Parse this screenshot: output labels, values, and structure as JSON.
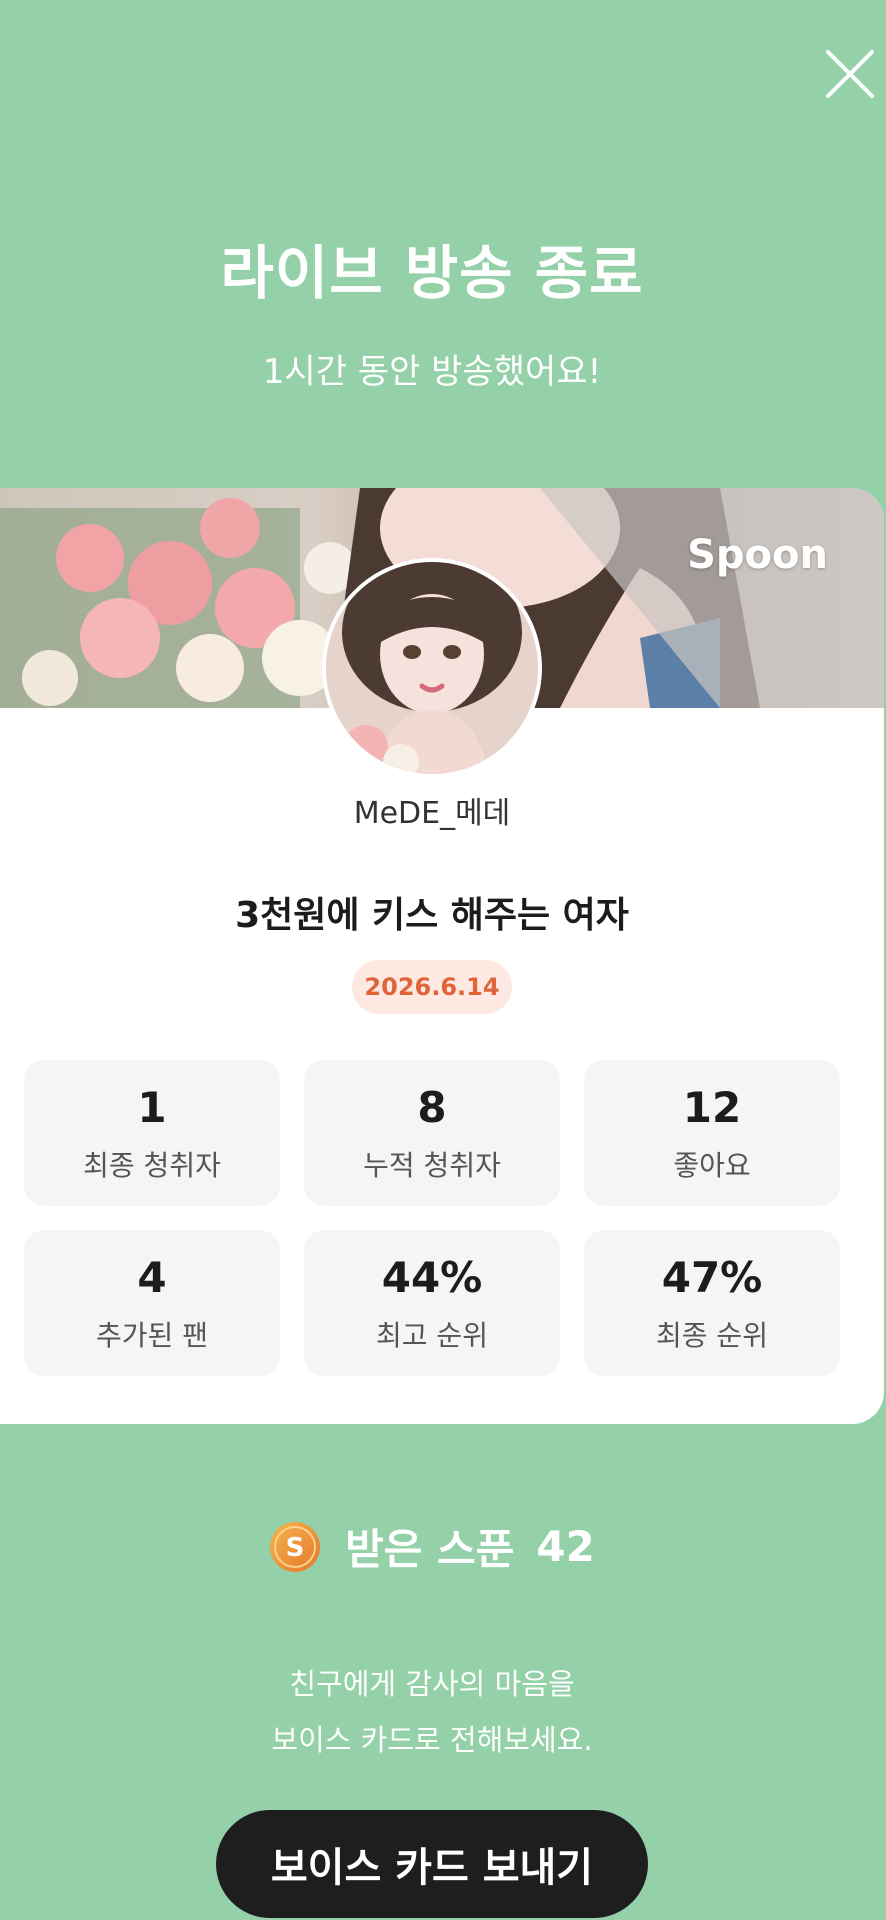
{
  "header": {
    "title": "라이브 방송 종료",
    "subtitle": "1시간 동안 방송했어요!"
  },
  "card": {
    "brand": "Spoon",
    "username": "MeDE_메데",
    "broadcast_title": "3천원에 키스 해주는 여자",
    "date": "2026.6.14",
    "stats": [
      {
        "value": "1",
        "label": "최종 청취자"
      },
      {
        "value": "8",
        "label": "누적 청취자"
      },
      {
        "value": "12",
        "label": "좋아요"
      },
      {
        "value": "4",
        "label": "추가된 팬"
      },
      {
        "value": "44%",
        "label": "최고 순위"
      },
      {
        "value": "47%",
        "label": "최종 순위"
      }
    ]
  },
  "spoon": {
    "icon": "spoon-coin-icon",
    "label": "받은 스푼",
    "count": "42"
  },
  "message": {
    "line1": "친구에게 감사의 마음을",
    "line2": "보이스 카드로 전해보세요."
  },
  "actions": {
    "voice_card_button": "보이스 카드 보내기",
    "close_icon": "close-icon"
  },
  "colors": {
    "background": "#94d1a9",
    "badge_bg": "#fde9e1",
    "badge_text": "#e0643a",
    "button_bg": "#1e1e1e"
  }
}
